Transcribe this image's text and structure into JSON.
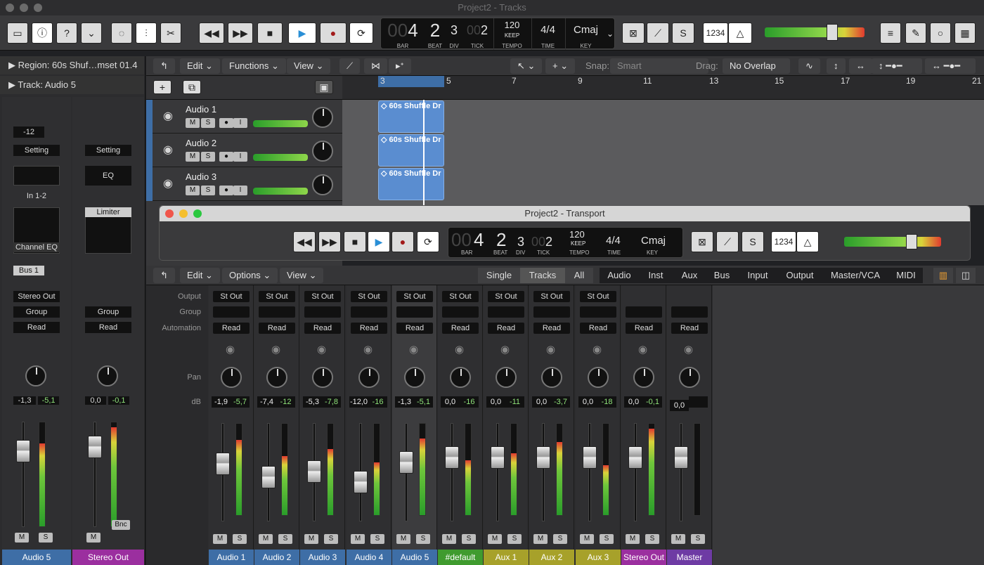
{
  "window": {
    "title": "Project2 - Tracks"
  },
  "lcd": {
    "bar_prefix": "00",
    "bar": "4",
    "beat": "2",
    "div": "3",
    "tick_prefix": "00",
    "tick": "2",
    "tempo": "120",
    "tempo_sub": "KEEP",
    "time": "4/4",
    "key": "Cmaj",
    "labels": {
      "bar": "BAR",
      "beat": "BEAT",
      "div": "DIV",
      "tick": "TICK",
      "tempo": "TEMPO",
      "time": "TIME",
      "key": "KEY"
    }
  },
  "countin": "1234",
  "inspector": {
    "region": "Region:  60s Shuf…mset 01.4",
    "track": "Track:  Audio 5",
    "strip1": {
      "gain": "-12",
      "setting": "Setting",
      "input": "In 1-2",
      "plugin": "Channel EQ",
      "bus": "Bus 1",
      "output": "Stereo Out",
      "group": "Group",
      "auto": "Read",
      "pan": "-1,3",
      "peak": "-5,1",
      "name": "Audio 5"
    },
    "strip2": {
      "setting": "Setting",
      "eq": "EQ",
      "plugin": "Limiter",
      "group": "Group",
      "auto": "Read",
      "pan": "0,0",
      "peak": "-0,1",
      "bnc": "Bnc",
      "name": "Stereo Out"
    }
  },
  "tracks_toolbar": {
    "edit": "Edit",
    "functions": "Functions",
    "view": "View",
    "snap_label": "Snap:",
    "snap": "Smart",
    "drag_label": "Drag:",
    "drag": "No Overlap"
  },
  "ruler": [
    "3",
    "5",
    "7",
    "9",
    "11",
    "13",
    "15",
    "17",
    "19",
    "21"
  ],
  "tracks": [
    {
      "name": "Audio 1",
      "region": "60s Shuffle Dr"
    },
    {
      "name": "Audio 2",
      "region": "60s Shuffle Dr"
    },
    {
      "name": "Audio 3",
      "region": "60s Shuffle Dr"
    }
  ],
  "transport_window": {
    "title": "Project2 - Transport"
  },
  "mixer_toolbar": {
    "edit": "Edit",
    "options": "Options",
    "view": "View",
    "tabs": [
      "Single",
      "Tracks",
      "All"
    ],
    "filters": [
      "Audio",
      "Inst",
      "Aux",
      "Bus",
      "Input",
      "Output",
      "Master/VCA",
      "MIDI"
    ]
  },
  "mixer_labels": {
    "output": "Output",
    "group": "Group",
    "automation": "Automation",
    "pan": "Pan",
    "db": "dB"
  },
  "strips": [
    {
      "name": "Audio 1",
      "out": "St Out",
      "auto": "Read",
      "v1": "-1,9",
      "v2": "-5,7",
      "color": "#3e6ea6",
      "fader": 0.62,
      "meter": 0.82
    },
    {
      "name": "Audio 2",
      "out": "St Out",
      "auto": "Read",
      "v1": "-7,4",
      "v2": "-12",
      "color": "#3e6ea6",
      "fader": 0.45,
      "meter": 0.65
    },
    {
      "name": "Audio 3",
      "out": "St Out",
      "auto": "Read",
      "v1": "-5,3",
      "v2": "-7,8",
      "color": "#3e6ea6",
      "fader": 0.52,
      "meter": 0.72
    },
    {
      "name": "Audio 4",
      "out": "St Out",
      "auto": "Read",
      "v1": "-12,0",
      "v2": "-16",
      "color": "#3e6ea6",
      "fader": 0.38,
      "meter": 0.58
    },
    {
      "name": "Audio 5",
      "out": "St Out",
      "auto": "Read",
      "v1": "-1,3",
      "v2": "-5,1",
      "color": "#3e6ea6",
      "fader": 0.64,
      "meter": 0.84
    },
    {
      "name": "#default",
      "out": "St Out",
      "auto": "Read",
      "v1": "0,0",
      "v2": "-16",
      "color": "#3f9b2e",
      "fader": 0.7,
      "meter": 0.6
    },
    {
      "name": "Aux 1",
      "out": "St Out",
      "auto": "Read",
      "v1": "0,0",
      "v2": "-11",
      "color": "#a7a12a",
      "fader": 0.7,
      "meter": 0.68
    },
    {
      "name": "Aux 2",
      "out": "St Out",
      "auto": "Read",
      "v1": "0,0",
      "v2": "-3,7",
      "color": "#a7a12a",
      "fader": 0.7,
      "meter": 0.8
    },
    {
      "name": "Aux 3",
      "out": "St Out",
      "auto": "Read",
      "v1": "0,0",
      "v2": "-18",
      "color": "#a7a12a",
      "fader": 0.7,
      "meter": 0.55
    },
    {
      "name": "Stereo Out",
      "out": "",
      "auto": "Read",
      "v1": "0,0",
      "v2": "-0,1",
      "color": "#9b2f9f",
      "fader": 0.7,
      "meter": 0.95
    },
    {
      "name": "Master",
      "out": "",
      "auto": "Read",
      "v1": "0,0",
      "v2": "",
      "color": "#6e3ba4",
      "fader": 0.7,
      "meter": 0
    }
  ]
}
